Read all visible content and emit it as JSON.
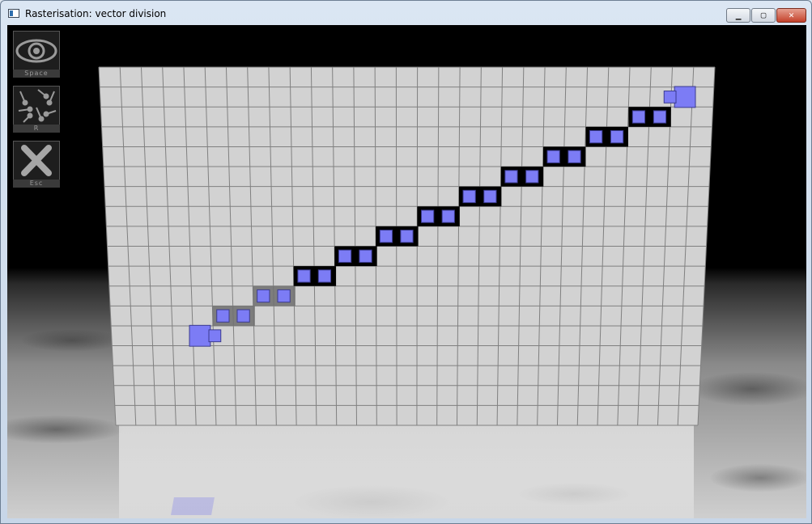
{
  "window": {
    "title": "Rasterisation: vector division",
    "controls": {
      "minimize": "▁",
      "maximize": "▢",
      "close": "✕"
    }
  },
  "toolbar": [
    {
      "key": "Space",
      "icon": "eye-icon"
    },
    {
      "key": "R",
      "icon": "scatter-vectors-icon"
    },
    {
      "key": "Esc",
      "icon": "close-x-icon"
    }
  ],
  "grid": {
    "columns": 29,
    "rows": 18
  },
  "pixel_path": [
    {
      "col": 4,
      "row": 13,
      "shade": "endpoint"
    },
    {
      "col": 5,
      "row": 12,
      "shade": "light"
    },
    {
      "col": 7,
      "row": 11,
      "shade": "light"
    },
    {
      "col": 9,
      "row": 10,
      "shade": "dark"
    },
    {
      "col": 11,
      "row": 9,
      "shade": "dark"
    },
    {
      "col": 13,
      "row": 8,
      "shade": "dark"
    },
    {
      "col": 15,
      "row": 7,
      "shade": "dark"
    },
    {
      "col": 17,
      "row": 6,
      "shade": "dark"
    },
    {
      "col": 19,
      "row": 5,
      "shade": "dark"
    },
    {
      "col": 21,
      "row": 4,
      "shade": "dark"
    },
    {
      "col": 23,
      "row": 3,
      "shade": "dark"
    },
    {
      "col": 25,
      "row": 2,
      "shade": "dark"
    },
    {
      "col": 27,
      "row": 1,
      "shade": "endpoint"
    }
  ],
  "colors": {
    "cube": "#7c7cf5",
    "cube_edge": "#3b3b8f",
    "cell_dark": "#000000",
    "cell_light": "#6f6f6f",
    "grid_face": "#d2d2d2",
    "grid_line": "#808080"
  }
}
